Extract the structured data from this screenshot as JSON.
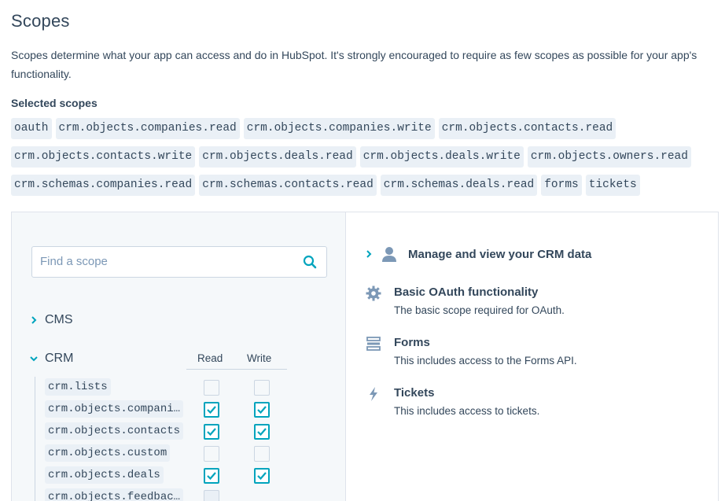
{
  "page": {
    "title": "Scopes",
    "description": "Scopes determine what your app can access and do in HubSpot. It's strongly encouraged to require as few scopes as possible for your app's functionality.",
    "selected_heading": "Selected scopes"
  },
  "selected_scopes": {
    "row1": [
      "oauth",
      "crm.objects.companies.read",
      "crm.objects.companies.write",
      "crm.objects.contacts.read"
    ],
    "row2": [
      "crm.objects.contacts.write",
      "crm.objects.deals.read",
      "crm.objects.deals.write",
      "crm.objects.owners.read"
    ],
    "row3": [
      "crm.schemas.companies.read",
      "crm.schemas.contacts.read",
      "crm.schemas.deals.read",
      "forms",
      "tickets"
    ]
  },
  "search": {
    "placeholder": "Find a scope"
  },
  "categories": {
    "cms": "CMS",
    "crm": "CRM"
  },
  "columns": {
    "read": "Read",
    "write": "Write"
  },
  "crm_scopes": [
    {
      "name": "crm.lists",
      "read": false,
      "write": false
    },
    {
      "name": "crm.objects.compani…",
      "read": true,
      "write": true
    },
    {
      "name": "crm.objects.contacts",
      "read": true,
      "write": true
    },
    {
      "name": "crm.objects.custom",
      "read": false,
      "write": false
    },
    {
      "name": "crm.objects.deals",
      "read": true,
      "write": true
    },
    {
      "name": "crm.objects.feedbac…",
      "read": false,
      "write": false
    }
  ],
  "right_panel": {
    "crm_group": "Manage and view your CRM data",
    "items": [
      {
        "title": "Basic OAuth functionality",
        "desc": "The basic scope required for OAuth.",
        "icon": "gear-icon"
      },
      {
        "title": "Forms",
        "desc": "This includes access to the Forms API.",
        "icon": "forms-icon"
      },
      {
        "title": "Tickets",
        "desc": "This includes access to tickets.",
        "icon": "lightning-icon"
      }
    ]
  },
  "colors": {
    "accent": "#00a4bd",
    "text": "#33475b",
    "tag_bg": "#eaf0f6"
  }
}
